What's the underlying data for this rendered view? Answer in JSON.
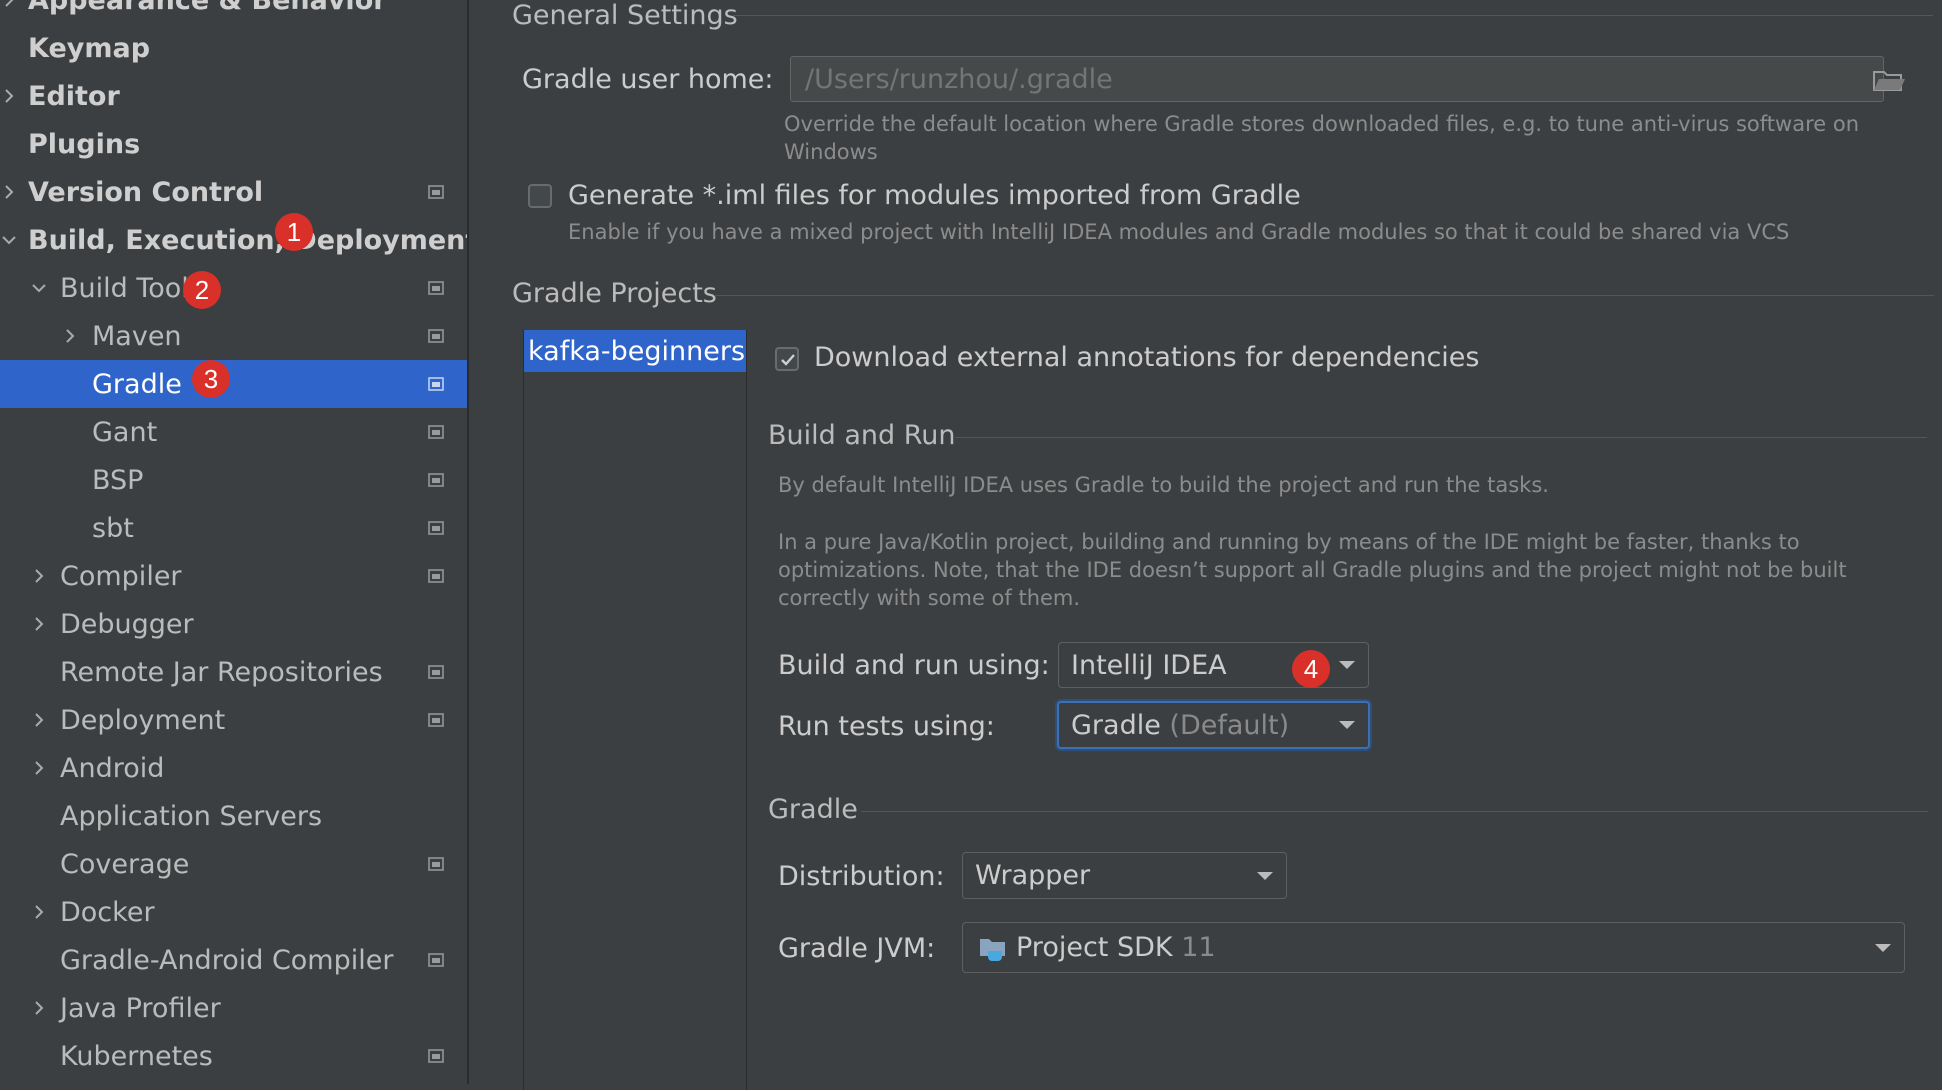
{
  "sidebar": {
    "items": [
      {
        "label": "Appearance & Behavior",
        "expandable": true,
        "expanded": false,
        "bold": true,
        "project_icon": false
      },
      {
        "label": "Keymap",
        "expandable": false,
        "bold": true,
        "project_icon": false
      },
      {
        "label": "Editor",
        "expandable": true,
        "expanded": false,
        "bold": true,
        "project_icon": false
      },
      {
        "label": "Plugins",
        "expandable": false,
        "bold": true,
        "project_icon": false
      },
      {
        "label": "Version Control",
        "expandable": true,
        "expanded": false,
        "bold": true,
        "project_icon": true
      },
      {
        "label": "Build, Execution, Deployment",
        "expandable": true,
        "expanded": true,
        "bold": true,
        "project_icon": false
      },
      {
        "label": "Build Tools",
        "expandable": true,
        "expanded": true,
        "bold": false,
        "project_icon": true
      },
      {
        "label": "Maven",
        "expandable": true,
        "expanded": false,
        "bold": false,
        "project_icon": true
      },
      {
        "label": "Gradle",
        "expandable": false,
        "bold": false,
        "project_icon": true,
        "selected": true
      },
      {
        "label": "Gant",
        "expandable": false,
        "bold": false,
        "project_icon": true
      },
      {
        "label": "BSP",
        "expandable": false,
        "bold": false,
        "project_icon": true
      },
      {
        "label": "sbt",
        "expandable": false,
        "bold": false,
        "project_icon": true
      },
      {
        "label": "Compiler",
        "expandable": true,
        "expanded": false,
        "bold": false,
        "project_icon": true
      },
      {
        "label": "Debugger",
        "expandable": true,
        "expanded": false,
        "bold": false,
        "project_icon": false
      },
      {
        "label": "Remote Jar Repositories",
        "expandable": false,
        "bold": false,
        "project_icon": true
      },
      {
        "label": "Deployment",
        "expandable": true,
        "expanded": false,
        "bold": false,
        "project_icon": true
      },
      {
        "label": "Android",
        "expandable": true,
        "expanded": false,
        "bold": false,
        "project_icon": false
      },
      {
        "label": "Application Servers",
        "expandable": false,
        "bold": false,
        "project_icon": false
      },
      {
        "label": "Coverage",
        "expandable": false,
        "bold": false,
        "project_icon": true
      },
      {
        "label": "Docker",
        "expandable": true,
        "expanded": false,
        "bold": false,
        "project_icon": false
      },
      {
        "label": "Gradle-Android Compiler",
        "expandable": false,
        "bold": false,
        "project_icon": true
      },
      {
        "label": "Java Profiler",
        "expandable": true,
        "expanded": false,
        "bold": false,
        "project_icon": false
      },
      {
        "label": "Kubernetes",
        "expandable": false,
        "bold": false,
        "project_icon": true
      }
    ]
  },
  "badges": [
    "1",
    "2",
    "3",
    "4"
  ],
  "general": {
    "title": "General Settings",
    "user_home_label": "Gradle user home:",
    "user_home_placeholder": "/Users/runzhou/.gradle",
    "user_home_hint_line1": "Override the default location where Gradle stores downloaded files, e.g. to tune anti-virus software on",
    "user_home_hint_line2": "Windows",
    "iml_checkbox_label": "Generate *.iml files for modules imported from Gradle",
    "iml_checked": false,
    "iml_hint": "Enable if you have a mixed project with IntelliJ IDEA modules and Gradle modules so that it could be shared via VCS"
  },
  "projects": {
    "title": "Gradle Projects",
    "items": [
      "kafka-beginners-"
    ],
    "download_annotations_label": "Download external annotations for dependencies",
    "download_annotations_checked": true
  },
  "build_run": {
    "title": "Build and Run",
    "desc1": "By default IntelliJ IDEA uses Gradle to build the project and run the tasks.",
    "desc2_line1": "In a pure Java/Kotlin project, building and running by means of the IDE might be faster, thanks to",
    "desc2_line2": "optimizations. Note, that the IDE doesn’t support all Gradle plugins and the project might not be built",
    "desc2_line3": "correctly with some of them.",
    "build_using_label": "Build and run using:",
    "build_using_value": "IntelliJ IDEA",
    "run_tests_label": "Run tests using:",
    "run_tests_value": "Gradle",
    "run_tests_suffix": "(Default)"
  },
  "gradle": {
    "title": "Gradle",
    "distribution_label": "Distribution:",
    "distribution_value": "Wrapper",
    "jvm_label": "Gradle JVM:",
    "jvm_value": "Project SDK",
    "jvm_version": "11"
  },
  "colors": {
    "background": "#3c3f41",
    "selection": "#2f65ca",
    "badge": "#d9302a",
    "focus": "#3d6fb3"
  }
}
